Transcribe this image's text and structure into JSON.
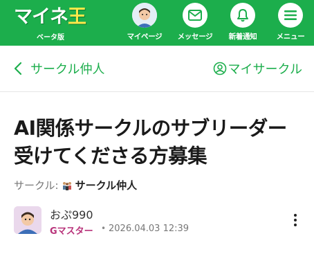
{
  "header": {
    "logo_text": "マイネ王",
    "beta_label": "ベータ版",
    "nav": [
      {
        "label": "マイページ",
        "icon": "avatar-icon"
      },
      {
        "label": "メッセージ",
        "icon": "mail-icon"
      },
      {
        "label": "新着通知",
        "icon": "bell-icon"
      },
      {
        "label": "メニュー",
        "icon": "menu-icon"
      }
    ],
    "brand_color": "#1cae4c"
  },
  "subbar": {
    "back_label": "サークル仲人",
    "my_circle_label": "マイサークル"
  },
  "post": {
    "title": "AI関係サークルのサブリーダー受けてくださる方募集",
    "circle_key": "サークル:",
    "circle_name": "サークル仲人",
    "author": "おぷ990",
    "rank": "Gマスター",
    "date": "2026.04.03 12:39"
  }
}
